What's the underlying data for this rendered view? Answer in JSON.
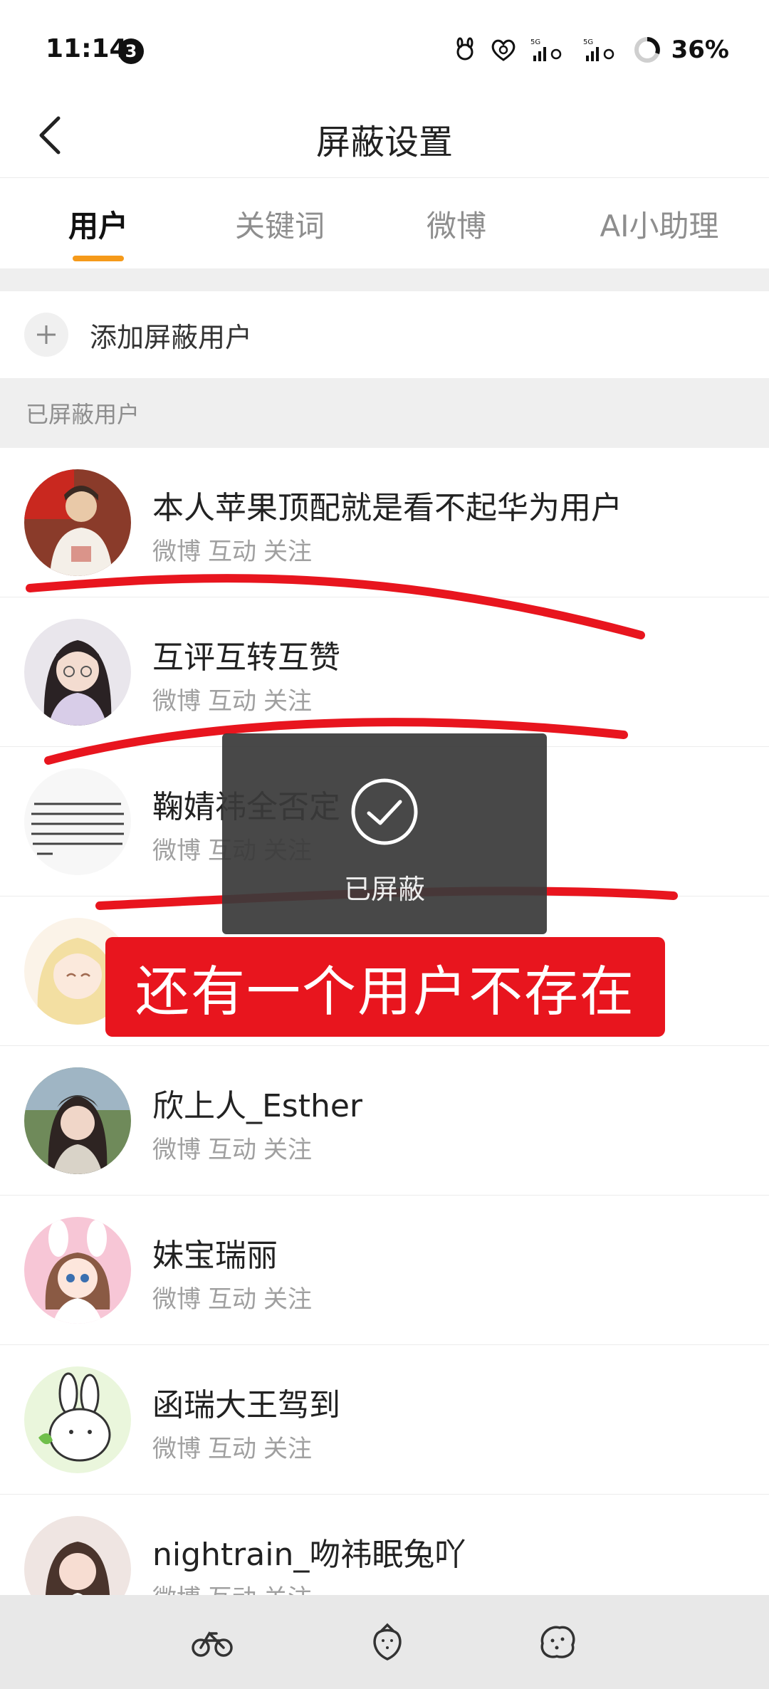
{
  "status_bar": {
    "time": "11:14",
    "notification_count": "3",
    "battery": "36%"
  },
  "header": {
    "title": "屏蔽设置"
  },
  "tabs": [
    {
      "label": "用户",
      "active": true
    },
    {
      "label": "关键词",
      "active": false
    },
    {
      "label": "微博",
      "active": false
    },
    {
      "label": "AI小助理",
      "active": false
    }
  ],
  "add_user": {
    "label": "添加屏蔽用户"
  },
  "section": {
    "label": "已屏蔽用户"
  },
  "tag_labels": [
    "微博",
    "互动",
    "关注"
  ],
  "users": [
    {
      "name": "本人苹果顶配就是看不起华为用户"
    },
    {
      "name": "互评互转互赞"
    },
    {
      "name": "鞠婧祎全否定"
    },
    {
      "name": ""
    },
    {
      "name": "欣上人_Esther"
    },
    {
      "name": "妹宝瑞丽"
    },
    {
      "name": "函瑞大王驾到"
    },
    {
      "name": "nightrain_吻祎眠兔吖"
    }
  ],
  "toast": {
    "text": "已屏蔽"
  },
  "annotation": {
    "text": "还有一个用户不存在",
    "color": "#e8151e"
  },
  "colors": {
    "accent": "#f59a1a",
    "red_mark": "#e8151e"
  },
  "bottom_bar": {
    "icons": [
      "bicycle-icon",
      "strawberry-icon",
      "cookie-icon"
    ]
  }
}
